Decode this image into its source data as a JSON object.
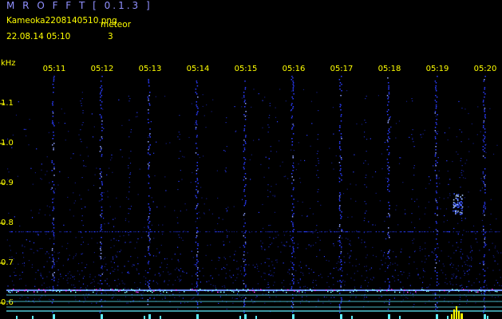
{
  "header": {
    "app_title": "M R O F F T [ 0.1.3 ]",
    "file_name": "Kameoka2208140510.png",
    "meteor_label": "meteor",
    "datetime": "22.08.14 05:10",
    "meteor_count": "3"
  },
  "colors": {
    "background": "#000000",
    "label_yellow": "#ffff00",
    "title_blue": "#9090ff",
    "baseline_cyan": "#5ff0ff",
    "noise_blue": "#2a3cff"
  },
  "chart_data": {
    "type": "heatmap",
    "ylabel": "kHz",
    "y_ticks": [
      "1.1",
      "1.0",
      "0.9",
      "0.8",
      "0.7",
      "0.6"
    ],
    "y_tick_values": [
      1.1,
      1.0,
      0.9,
      0.8,
      0.7,
      0.6
    ],
    "x_ticks": [
      "05:11",
      "05:12",
      "05:13",
      "05:14",
      "05:15",
      "05:16",
      "05:17",
      "05:18",
      "05:19",
      "05:20"
    ],
    "ylim": [
      0.6,
      1.15
    ],
    "meteor_echo": {
      "time": "05:19.5",
      "freq_khz": 0.85
    }
  }
}
